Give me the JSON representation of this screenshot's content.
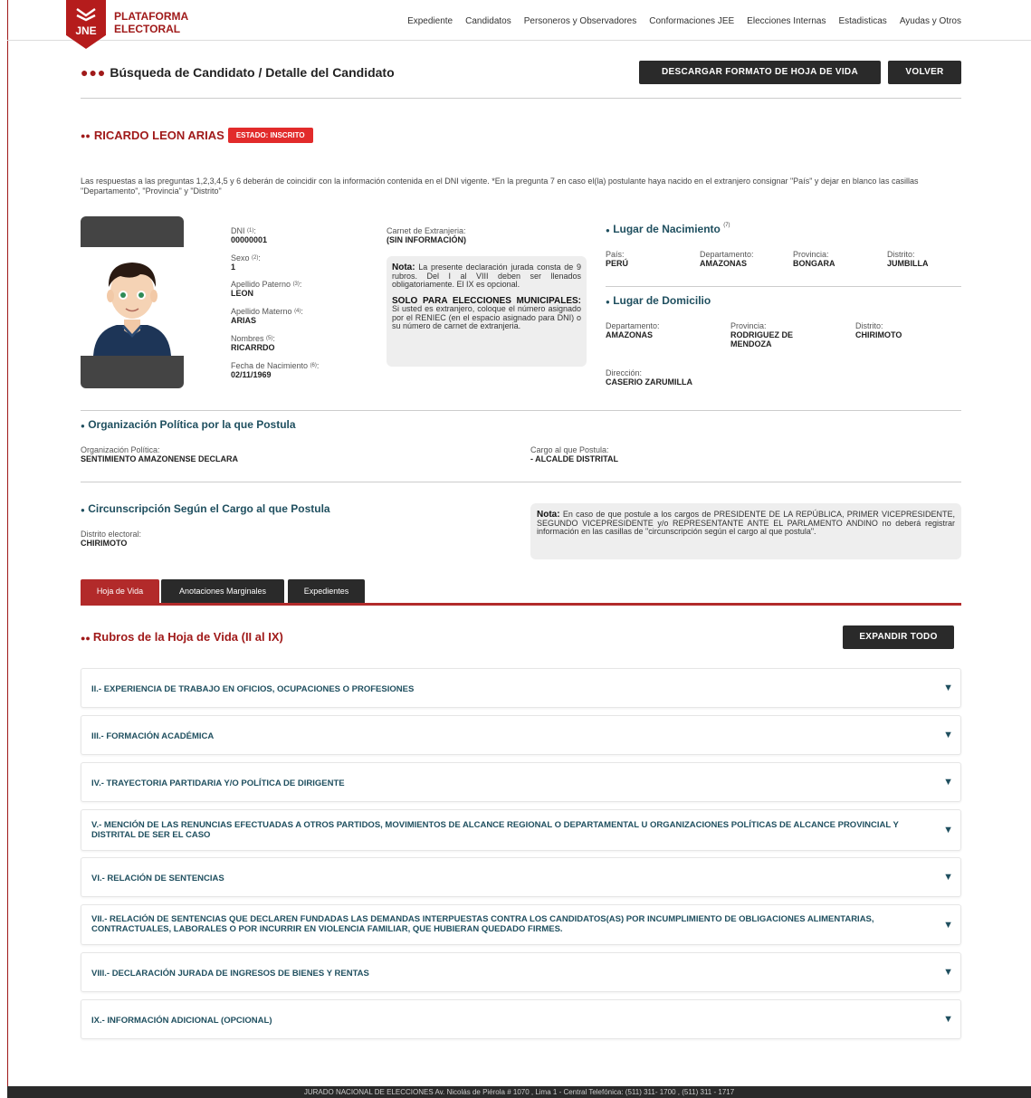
{
  "header": {
    "logo_line1": "PLATAFORMA",
    "logo_line2": "ELECTORAL",
    "logo_abbr": "JNE",
    "nav": [
      "Expediente",
      "Candidatos",
      "Personeros y Observadores",
      "Conformaciones JEE",
      "Elecciones Internas",
      "Estadisticas",
      "Ayudas y Otros"
    ]
  },
  "page": {
    "title": "Búsqueda de Candidato / Detalle del Candidato",
    "download_button": "DESCARGAR FORMATO DE HOJA DE VIDA",
    "back_button": "VOLVER"
  },
  "candidate": {
    "name": "RICARDO LEON ARIAS",
    "status": "ESTADO: INSCRITO",
    "intro": "Las respuestas a las preguntas 1,2,3,4,5 y 6 deberán de coincidir con la información contenida en el DNI vigente. *En la pregunta 7 en caso el(la) postulante haya nacido en el extranjero consignar \"País\" y dejar en blanco las casillas \"Departamento\", \"Provincia\" y \"Distrito\"",
    "dni_label": "DNI",
    "dni_sup": "(1)",
    "dni": "00000001",
    "sexo_label": "Sexo",
    "sexo_sup": "(2)",
    "sexo": "1",
    "ap_pat_label": "Apellido Paterno",
    "ap_pat_sup": "(3)",
    "ap_pat": "LEON",
    "ap_mat_label": "Apellido Materno",
    "ap_mat_sup": "(4)",
    "ap_mat": "ARIAS",
    "nombres_label": "Nombres",
    "nombres_sup": "(5)",
    "nombres": "RICARRDO",
    "fecha_label": "Fecha de Nacimiento",
    "fecha_sup": "(6)",
    "fecha": "02/11/1969",
    "carnet_label": "Carnet de Extranjeria:",
    "carnet": "(SIN INFORMACIÓN)",
    "nota_bold": "Nota:",
    "nota_text": " La presente declaración jurada consta de 9 rubros. Del I al VIII deben ser llenados obligatoriamente. El IX es opcional.",
    "solo_bold": "SOLO PARA ELECCIONES MUNICIPALES:",
    "solo_text": " Si usted es extranjero, coloque el número asignado por el RENIEC (en el espacio asignado para DNI) o su número de carnet de extranjeria."
  },
  "nacimiento": {
    "title": "Lugar de Nacimiento",
    "sup": "(7)",
    "pais_label": "País:",
    "pais": "PERÚ",
    "dep_label": "Departamento:",
    "dep": "AMAZONAS",
    "prov_label": "Provincia:",
    "prov": "BONGARA",
    "dist_label": "Distrito:",
    "dist": "JUMBILLA"
  },
  "domicilio": {
    "title": "Lugar de Domicilio",
    "dep_label": "Departamento:",
    "dep": "AMAZONAS",
    "prov_label": "Provincia:",
    "prov": "RODRIGUEZ DE MENDOZA",
    "dist_label": "Distrito:",
    "dist": "CHIRIMOTO",
    "dir_label": "Dirección:",
    "dir": "CASERIO ZARUMILLA"
  },
  "organizacion": {
    "title": "Organización Política por la que Postula",
    "org_label": "Organización Política:",
    "org": "SENTIMIENTO AMAZONENSE DECLARA",
    "cargo_label": "Cargo al que Postula:",
    "cargo": "- ALCALDE DISTRITAL"
  },
  "circunscripcion": {
    "title": "Circunscripción Según el Cargo al que Postula",
    "dist_label": "Distrito electoral:",
    "dist": "CHIRIMOTO",
    "nota_bold": "Nota:",
    "nota_text": " En caso de que postule a los cargos de PRESIDENTE DE LA REPÚBLICA, PRIMER VICEPRESIDENTE, SEGUNDO VICEPRESIDENTE y/o REPRESENTANTE ANTE EL PARLAMENTO ANDINO no deberá registrar información en las casillas de \"circunscripción según el cargo al que postula\"."
  },
  "tabs": [
    "Hoja de Vida",
    "Anotaciones Marginales",
    "Expedientes"
  ],
  "rubros": {
    "title": "Rubros de la Hoja de Vida (II al IX)",
    "expand_button": "EXPANDIR TODO",
    "items": [
      "II.- EXPERIENCIA DE TRABAJO EN OFICIOS, OCUPACIONES O PROFESIONES",
      "III.- FORMACIÓN ACADÉMICA",
      "IV.- TRAYECTORIA PARTIDARIA Y/O POLÍTICA DE DIRIGENTE",
      "V.- MENCIÓN DE LAS RENUNCIAS EFECTUADAS A OTROS PARTIDOS, MOVIMIENTOS DE ALCANCE REGIONAL O DEPARTAMENTAL U ORGANIZACIONES POLÍTICAS DE ALCANCE PROVINCIAL Y DISTRITAL DE SER EL CASO",
      "VI.- RELACIÓN DE SENTENCIAS",
      "VII.- RELACIÓN DE SENTENCIAS QUE DECLAREN FUNDADAS LAS DEMANDAS INTERPUESTAS CONTRA LOS CANDIDATOS(AS) POR INCUMPLIMIENTO DE OBLIGACIONES ALIMENTARIAS, CONTRACTUALES, LABORALES O POR INCURRIR EN VIOLENCIA FAMILIAR, QUE HUBIERAN QUEDADO FIRMES.",
      "VIII.- DECLARACIÓN JURADA DE INGRESOS DE BIENES Y RENTAS",
      "IX.- INFORMACIÓN ADICIONAL (OPCIONAL)"
    ]
  },
  "footer": "JURADO NACIONAL DE ELECCIONES Av. Nicolás de Piérola # 1070 , Lima 1 - Central Telefónica: (511) 311- 1700 , (511) 311 - 1717",
  "icons": {
    "accordion_toggle": "triangle-down-icon",
    "bullet": "dot-icon"
  }
}
